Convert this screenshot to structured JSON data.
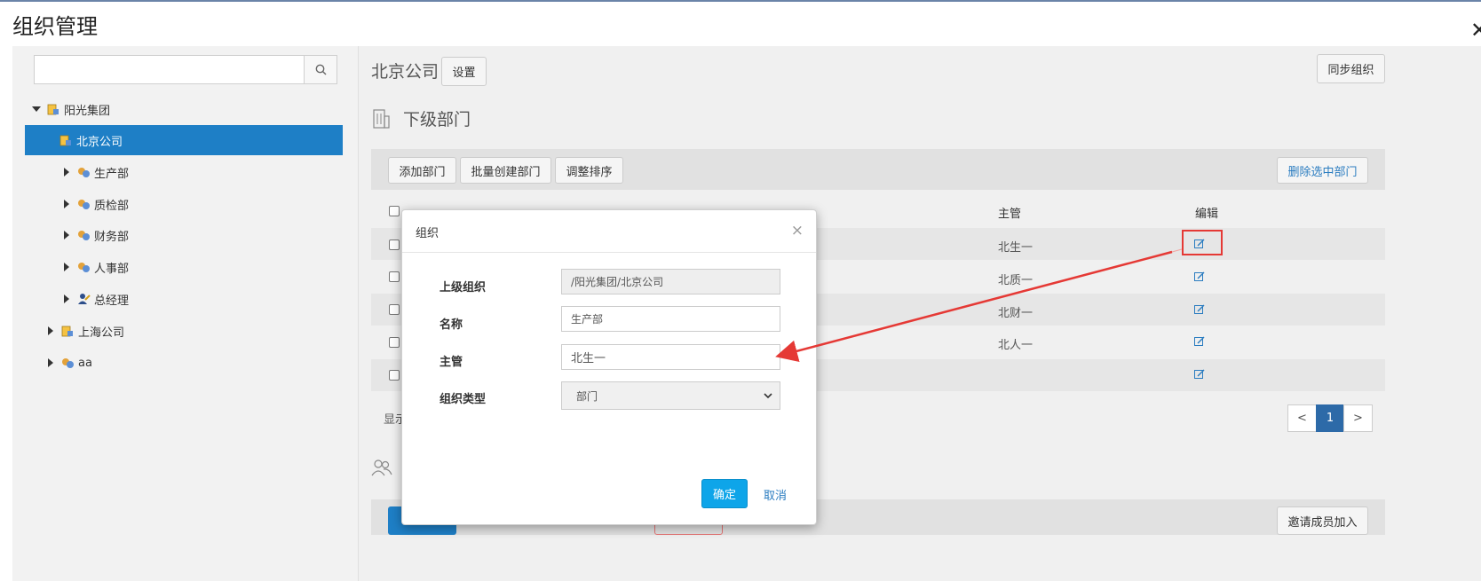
{
  "page": {
    "title": "组织管理"
  },
  "tree": {
    "search": {
      "value": "",
      "placeholder": ""
    },
    "nodes": [
      {
        "label": "阳光集团",
        "icon": "company-icon"
      },
      {
        "label": "北京公司",
        "icon": "company-icon",
        "selected": true
      },
      {
        "label": "生产部",
        "icon": "department-icon"
      },
      {
        "label": "质检部",
        "icon": "department-icon"
      },
      {
        "label": "财务部",
        "icon": "department-icon"
      },
      {
        "label": "人事部",
        "icon": "department-icon"
      },
      {
        "label": "总经理",
        "icon": "position-icon"
      },
      {
        "label": "上海公司",
        "icon": "company-icon"
      },
      {
        "label": "aa",
        "icon": "department-icon"
      }
    ]
  },
  "header": {
    "company": "北京公司",
    "settings_label": "设置",
    "sync_label": "同步组织"
  },
  "departments": {
    "title": "下级部门",
    "toolbar": {
      "add": "添加部门",
      "batch_create": "批量创建部门",
      "reorder": "调整排序",
      "delete_selected": "删除选中部门"
    },
    "columns": {
      "manager": "主管",
      "edit": "编辑"
    },
    "rows": [
      {
        "manager": "北生一"
      },
      {
        "manager": "北质一"
      },
      {
        "manager": "北财一"
      },
      {
        "manager": "北人一"
      },
      {
        "manager": ""
      }
    ],
    "show_text": "显示",
    "pagination": {
      "prev": "<",
      "page": "1",
      "next": ">"
    }
  },
  "members": {
    "invite_label": "邀请成员加入"
  },
  "modal": {
    "title": "组织",
    "close": "×",
    "fields": {
      "parent": {
        "label": "上级组织",
        "value": "/阳光集团/北京公司"
      },
      "name": {
        "label": "名称",
        "value": "生产部"
      },
      "manager": {
        "label": "主管",
        "value": "北生一"
      },
      "type": {
        "label": "组织类型",
        "value": "部门"
      }
    },
    "confirm": "确定",
    "cancel": "取消"
  },
  "colors": {
    "selected": "#1e7fc6",
    "primary_button": "#0ea5e9",
    "link": "#2a7cc0",
    "highlight": "#e53935",
    "page_active": "#2d6aa8"
  }
}
